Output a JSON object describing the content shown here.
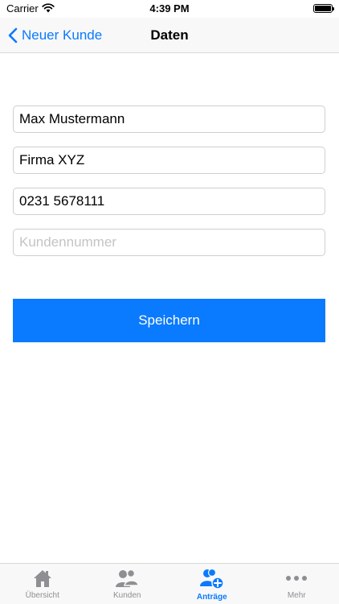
{
  "status_bar": {
    "carrier": "Carrier",
    "time": "4:39 PM",
    "battery_level": 1.0
  },
  "nav": {
    "back_label": "Neuer Kunde",
    "title": "Daten"
  },
  "form": {
    "name": {
      "value": "Max Mustermann",
      "placeholder": ""
    },
    "company": {
      "value": "Firma XYZ",
      "placeholder": ""
    },
    "phone": {
      "value": "0231 5678111",
      "placeholder": ""
    },
    "customer_number": {
      "value": "",
      "placeholder": "Kundennummer"
    },
    "save_label": "Speichern"
  },
  "tabs": [
    {
      "label": "Übersicht",
      "icon": "house-icon",
      "active": false
    },
    {
      "label": "Kunden",
      "icon": "people-icon",
      "active": false
    },
    {
      "label": "Anträge",
      "icon": "person-add-icon",
      "active": true
    },
    {
      "label": "Mehr",
      "icon": "more-icon",
      "active": false
    }
  ],
  "colors": {
    "accent": "#0a7aff",
    "tab_inactive": "#8e8e93",
    "bar_background": "#f8f8f8"
  }
}
